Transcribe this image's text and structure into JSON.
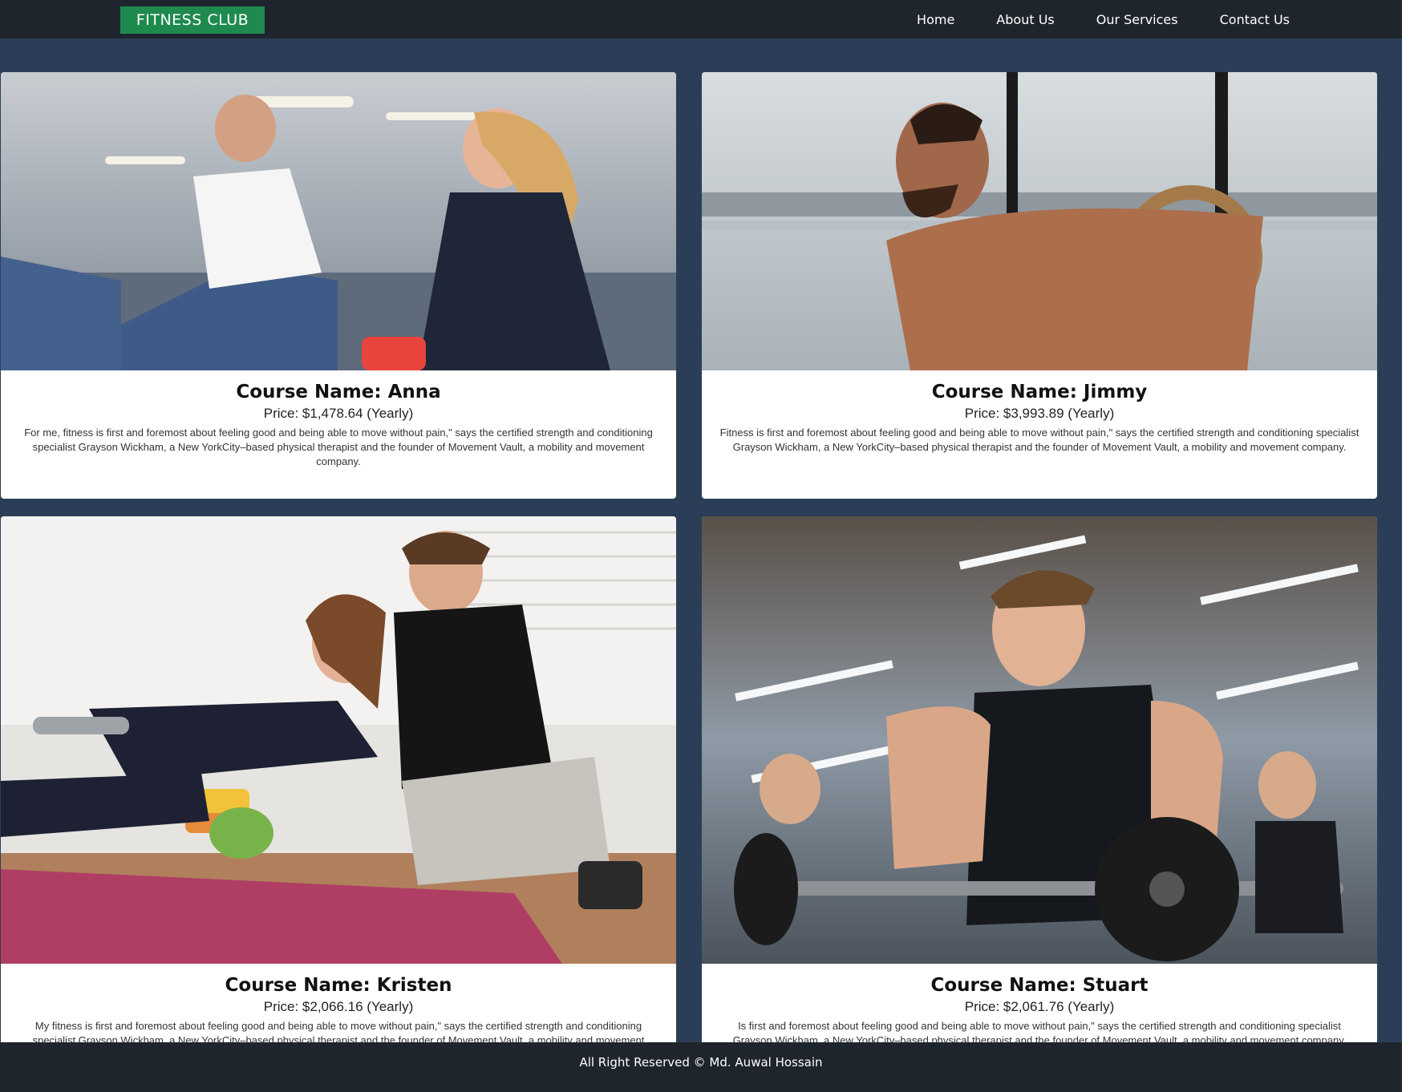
{
  "navbar": {
    "brand": "FITNESS CLUB",
    "links": [
      "Home",
      "About Us",
      "Our Services",
      "Contact Us"
    ]
  },
  "cards": [
    {
      "title": "Course Name: Anna",
      "price": "Price: $1,478.64 (Yearly)",
      "description": "For me, fitness is first and foremost about feeling good and being able to move without pain,\" says the certified strength and conditioning specialist Grayson Wickham, a New YorkCity–based physical therapist and the founder of Movement Vault, a mobility and movement company."
    },
    {
      "title": "Course Name: Jimmy",
      "price": "Price: $3,993.89 (Yearly)",
      "description": "Fitness is first and foremost about feeling good and being able to move without pain,\" says the certified strength and conditioning specialist Grayson Wickham, a New YorkCity–based physical therapist and the founder of Movement Vault, a mobility and movement company."
    },
    {
      "title": "Course Name: Kristen",
      "price": "Price: $2,066.16 (Yearly)",
      "description": "My fitness is first and foremost about feeling good and being able to move without pain,\" says the certified strength and conditioning specialist Grayson Wickham, a New YorkCity–based physical therapist and the founder of Movement Vault, a mobility and movement company."
    },
    {
      "title": "Course Name: Stuart",
      "price": "Price: $2,061.76 (Yearly)",
      "description": "Is first and foremost about feeling good and being able to move without pain,\" says the certified strength and conditioning specialist Grayson Wickham, a New YorkCity–based physical therapist and the founder of Movement Vault, a mobility and movement company."
    }
  ],
  "footer": {
    "text": "All Right Reserved © Md. Auwal Hossain"
  },
  "colors": {
    "navbar_bg": "#1f252d",
    "brand_bg": "#1f8a4e",
    "page_bg": "#2c3e57",
    "card_bg": "#ffffff"
  }
}
